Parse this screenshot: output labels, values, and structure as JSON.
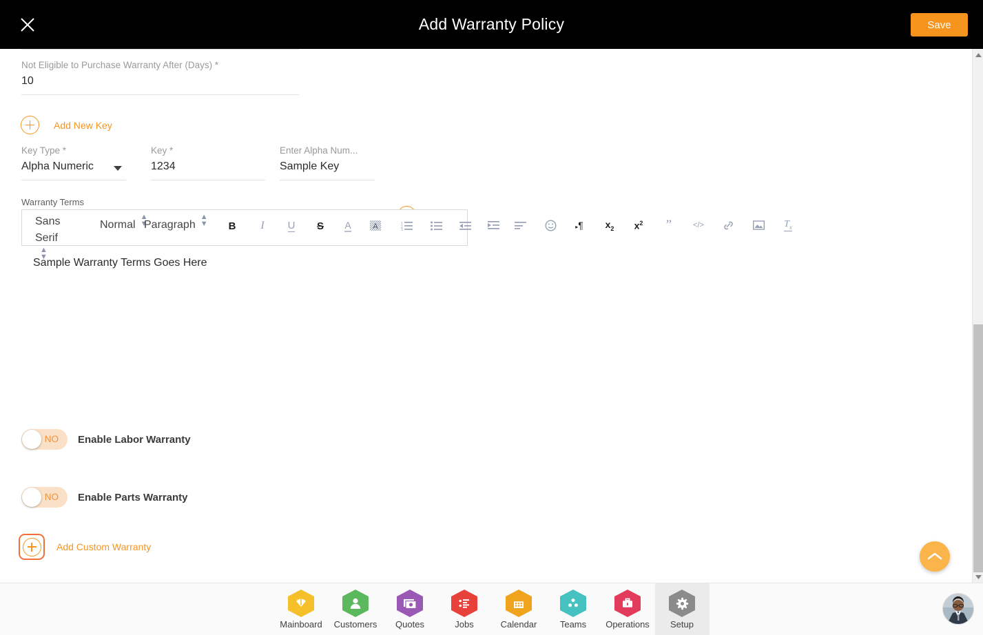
{
  "header": {
    "title": "Add Warranty Policy",
    "save_label": "Save",
    "close_icon": "close-icon",
    "background": "#000000",
    "save_color": "#f7941e"
  },
  "form": {
    "days_field": {
      "label": "Not Eligible to Purchase Warranty After (Days) *",
      "value": "10"
    },
    "add_new_key_label": "Add New Key",
    "key_row": {
      "key_type": {
        "label": "Key Type *",
        "value": "Alpha Numeric"
      },
      "key": {
        "label": "Key *",
        "value": "1234"
      },
      "alpha": {
        "label": "Enter Alpha Num...",
        "value": "Sample Key"
      },
      "remove_icon": "minus-circle-icon"
    },
    "warranty_terms": {
      "label": "Warranty Terms",
      "content": "Sample Warranty Terms Goes Here",
      "toolbar": {
        "font": "Sans Serif",
        "size": "Normal",
        "block": "Paragraph",
        "buttons": [
          {
            "name": "bold-icon",
            "glyph": "B"
          },
          {
            "name": "italic-icon",
            "glyph": "I"
          },
          {
            "name": "underline-icon",
            "glyph": "U"
          },
          {
            "name": "strikethrough-icon",
            "glyph": "S"
          },
          {
            "name": "text-color-icon",
            "glyph": "A"
          },
          {
            "name": "background-color-icon",
            "glyph": "A"
          },
          {
            "name": "ordered-list-icon",
            "glyph": ""
          },
          {
            "name": "bullet-list-icon",
            "glyph": ""
          },
          {
            "name": "indent-decrease-icon",
            "glyph": ""
          },
          {
            "name": "indent-increase-icon",
            "glyph": ""
          },
          {
            "name": "align-icon",
            "glyph": ""
          },
          {
            "name": "emoji-icon",
            "glyph": ""
          },
          {
            "name": "text-direction-icon",
            "glyph": "¶"
          },
          {
            "name": "subscript-icon",
            "glyph": "x"
          },
          {
            "name": "superscript-icon",
            "glyph": "x"
          },
          {
            "name": "blockquote-icon",
            "glyph": "”"
          },
          {
            "name": "code-block-icon",
            "glyph": "</>"
          },
          {
            "name": "link-icon",
            "glyph": ""
          },
          {
            "name": "image-icon",
            "glyph": ""
          },
          {
            "name": "clear-formatting-icon",
            "glyph": "T"
          }
        ]
      }
    },
    "toggles": [
      {
        "name": "enable-labor-warranty",
        "label": "Enable Labor Warranty",
        "state": "NO"
      },
      {
        "name": "enable-parts-warranty",
        "label": "Enable Parts Warranty",
        "state": "NO"
      }
    ],
    "add_custom_warranty_label": "Add Custom Warranty"
  },
  "scroll_top": {
    "icon": "chevron-up-icon",
    "color": "#fbb449"
  },
  "bottom_nav": {
    "active": "Setup",
    "items": [
      {
        "label": "Mainboard",
        "icon": "mainboard-icon",
        "color": "#f5c02a"
      },
      {
        "label": "Customers",
        "icon": "customers-icon",
        "color": "#5cb85c"
      },
      {
        "label": "Quotes",
        "icon": "quotes-icon",
        "color": "#9b59b6"
      },
      {
        "label": "Jobs",
        "icon": "jobs-icon",
        "color": "#e8413a"
      },
      {
        "label": "Calendar",
        "icon": "calendar-icon",
        "color": "#f0a41e"
      },
      {
        "label": "Teams",
        "icon": "teams-icon",
        "color": "#45c1bf"
      },
      {
        "label": "Operations",
        "icon": "operations-icon",
        "color": "#e23b5c"
      },
      {
        "label": "Setup",
        "icon": "gear-icon",
        "color": "#8b8b8b"
      }
    ],
    "avatar_name": "user-avatar"
  }
}
